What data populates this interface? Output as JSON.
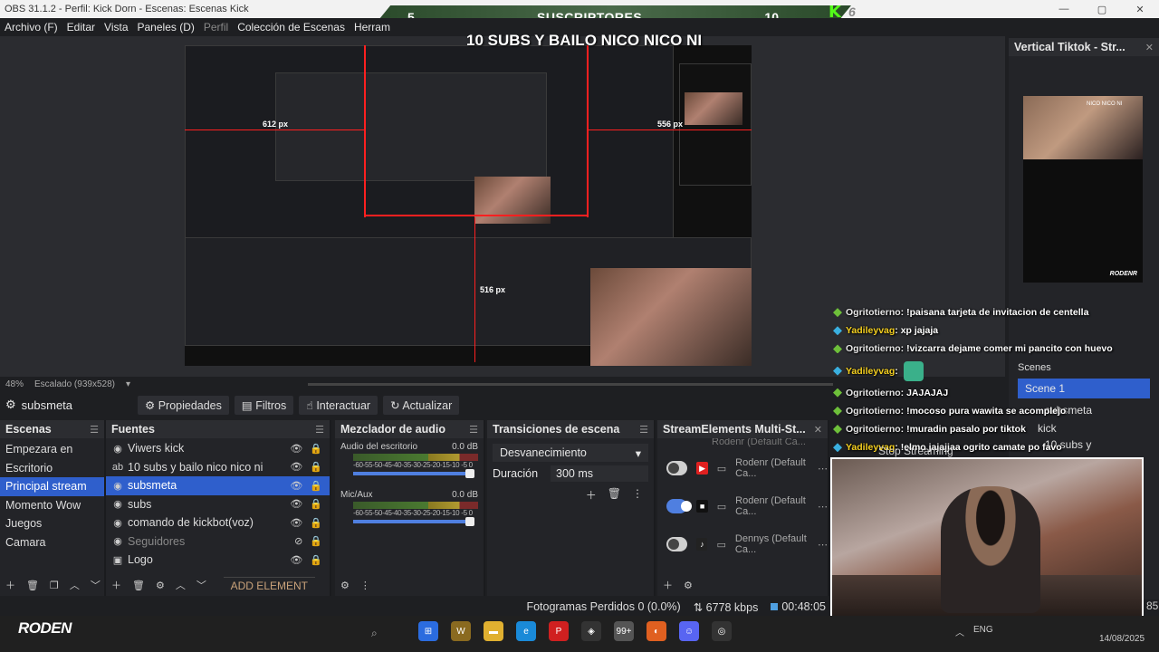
{
  "window": {
    "title": "OBS 31.1.2 - Perfil: Kick Dorn - Escenas: Escenas Kick"
  },
  "overlay": {
    "left_count": "5",
    "label": "SUSCRIPTORES",
    "right_count": "10",
    "kick_count": "6",
    "headline": "10 SUBS Y BAILO NICO NICO NI"
  },
  "menu": {
    "items": [
      "Archivo (F)",
      "Editar",
      "Vista",
      "Paneles (D)",
      "Perfil",
      "Colección de Escenas",
      "Herram"
    ]
  },
  "preview": {
    "px_left": "612 px",
    "px_right": "556 px",
    "px_bottom": "516 px",
    "zoom": "48%",
    "scaling": "Escalado (939x528)",
    "nested": {
      "toolbar_label": "subsmeta",
      "buttons": [
        "Propiedades",
        "Filtros",
        "Interactuar",
        "Actualizar"
      ],
      "status": "Fotogramas Perdidos 0 (0.0%)",
      "kbps": "6778 kbps",
      "panel_title": "Vertical Tiktok - Str...",
      "scenes_title": "Scenes",
      "scene1": "Scene 1"
    }
  },
  "source_bar": {
    "current": "subsmeta",
    "props": "Propiedades",
    "filters": "Filtros",
    "interact": "Interactuar",
    "refresh": "Actualizar"
  },
  "scenes": {
    "title": "Escenas",
    "items": [
      "Empezara en",
      "Escritorio",
      "Principal stream",
      "Momento Wow",
      "Juegos",
      "Camara"
    ],
    "selected": 2
  },
  "sources": {
    "title": "Fuentes",
    "items": [
      "Viwers kick",
      "10 subs y bailo nico nico ni",
      "subsmeta",
      "subs",
      "comando de kickbot(voz)",
      "Seguidores",
      "Logo"
    ],
    "selected": 2,
    "add": "ADD ELEMENT"
  },
  "mixer": {
    "title": "Mezclador de audio",
    "channels": [
      {
        "name": "Audio del escritorio",
        "db": "0.0 dB"
      },
      {
        "name": "Mic/Aux",
        "db": "0.0 dB"
      }
    ],
    "scale": "-60-55-50-45-40-35-30-25-20-15-10 -5  0"
  },
  "transitions": {
    "title": "Transiciones de escena",
    "selected": "Desvanecimiento",
    "duration_label": "Duración",
    "duration": "300 ms"
  },
  "multistream": {
    "title": "StreamElements Multi-St...",
    "top_cut": "Rodenr (Default Ca...",
    "rows": [
      {
        "platform": "youtube",
        "target": "Rodenr (Default Ca...",
        "on": false
      },
      {
        "platform": "kick",
        "target": "Rodenr (Default Ca...",
        "on": true
      },
      {
        "platform": "tiktok",
        "target": "Dennys (Default Ca...",
        "on": false
      }
    ]
  },
  "vertical": {
    "title": "Vertical Tiktok - Str...",
    "cam_caption": "NICO NICO NI",
    "brand": "RODENR",
    "scenes_label": "Scenes",
    "scene1": "Scene 1",
    "src1": "subsmeta",
    "src2": "kick",
    "src3": "10 subs y"
  },
  "chat": [
    {
      "user": "Ogritotierno",
      "text": ": !paisana tarjeta de invitacion de centella",
      "color": "u1",
      "gem": "g"
    },
    {
      "user": "Yadileyvag",
      "text": ": xp jajaja",
      "color": "u2",
      "gem": "b"
    },
    {
      "user": "Ogritotierno",
      "text": ": !vizcarra dejame comer mi pancito con huevo",
      "color": "u1",
      "gem": "g"
    },
    {
      "user": "Yadileyvag",
      "text": ":",
      "color": "u2",
      "gem": "b"
    },
    {
      "user": "Ogritotierno",
      "text": ": JAJAJAJ",
      "color": "u1",
      "gem": "g"
    },
    {
      "user": "Ogritotierno",
      "text": ": !mocoso pura wawita se acomplejo",
      "color": "u1",
      "gem": "g"
    },
    {
      "user": "Ogritotierno",
      "text": ": !muradin pasalo por tiktok",
      "color": "u1",
      "gem": "g"
    },
    {
      "user": "Yadileyvag",
      "text": ": !elmo jajajjaa ogrito camate po favo",
      "color": "u2",
      "gem": "b"
    }
  ],
  "stop_streaming": "Stop Streaming",
  "status": {
    "frames": "Fotogramas Perdidos 0 (0.0%)",
    "kbps": "6778 kbps",
    "time": "00:48:05",
    "side": "85"
  },
  "taskbar": {
    "logo": "RODEN",
    "badge": "99+",
    "lang": "ENG",
    "date": "14/08/2025"
  }
}
